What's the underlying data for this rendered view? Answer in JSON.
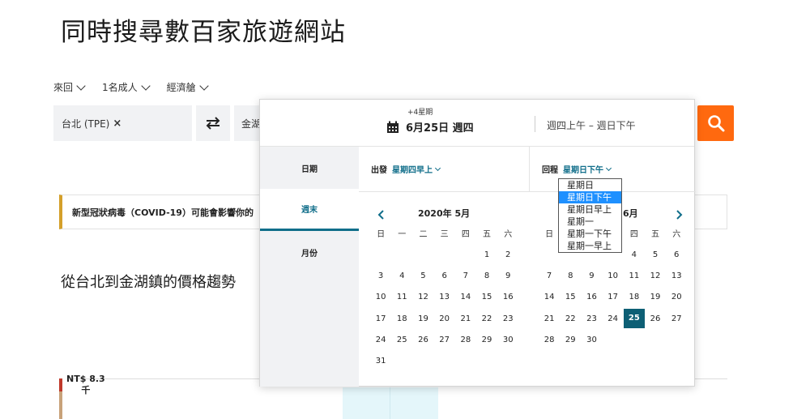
{
  "page": {
    "title": "同時搜尋數百家旅遊網站"
  },
  "options": {
    "trip_type": "來回",
    "travelers": "1名成人",
    "cabin": "經濟艙"
  },
  "search": {
    "origin": "台北 (TPE)",
    "origin_remove": "×",
    "destination": "金湖"
  },
  "notice": {
    "text": "新型冠狀病毒（COVID-19）可能會影響你的"
  },
  "trend": {
    "title": "從台北到金湖鎮的價格趨勢"
  },
  "chart": {
    "y_label_line1": "NT$ 8.3",
    "y_label_line2": "千"
  },
  "popup": {
    "offset": "+4星期",
    "departure_date": "6月25日 週四",
    "return_range": "週四上午 – 週日下午",
    "tabs": [
      {
        "label": "日期",
        "active": false
      },
      {
        "label": "週末",
        "active": true
      },
      {
        "label": "月份",
        "active": false
      }
    ],
    "depart_label": "出發",
    "depart_value": "星期四早上",
    "return_label": "回程",
    "return_value": "星期日下午",
    "months": {
      "may_title": "2020年 5月",
      "jun_title_tail": "6月"
    },
    "weekdays": [
      "日",
      "一",
      "二",
      "三",
      "四",
      "五",
      "六"
    ],
    "may_weeks": [
      [
        "",
        "",
        "",
        "",
        "",
        "1",
        "2"
      ],
      [
        "3",
        "4",
        "5",
        "6",
        "7",
        "8",
        "9"
      ],
      [
        "10",
        "11",
        "12",
        "13",
        "14",
        "15",
        "16"
      ],
      [
        "17",
        "18",
        "19",
        "20",
        "21",
        "22",
        "23"
      ],
      [
        "24",
        "25",
        "26",
        "27",
        "28",
        "29",
        "30"
      ],
      [
        "31",
        "",
        "",
        "",
        "",
        "",
        ""
      ]
    ],
    "jun_weekdays_visible": [
      "日",
      "",
      "",
      "",
      "四",
      "五",
      "六"
    ],
    "jun_weeks": [
      [
        "",
        "",
        "",
        "",
        "4",
        "5",
        "6"
      ],
      [
        "7",
        "8",
        "9",
        "10",
        "11",
        "12",
        "13"
      ],
      [
        "14",
        "15",
        "16",
        "17",
        "18",
        "19",
        "20"
      ],
      [
        "21",
        "22",
        "23",
        "24",
        "25",
        "26",
        "27"
      ],
      [
        "28",
        "29",
        "30",
        "",
        "",
        "",
        ""
      ]
    ],
    "selected_day": "25",
    "dropdown": [
      {
        "label": "星期日",
        "highlight": false
      },
      {
        "label": "星期日下午",
        "highlight": true
      },
      {
        "label": "星期日早上",
        "highlight": false
      },
      {
        "label": "星期一",
        "highlight": false
      },
      {
        "label": "星期一下午",
        "highlight": false
      },
      {
        "label": "星期一早上",
        "highlight": false
      }
    ]
  },
  "colors": {
    "accent": "#106e8a",
    "search_button": "#ff690f",
    "selected_day": "#0d5f75",
    "dropdown_highlight": "#1e90ff"
  }
}
